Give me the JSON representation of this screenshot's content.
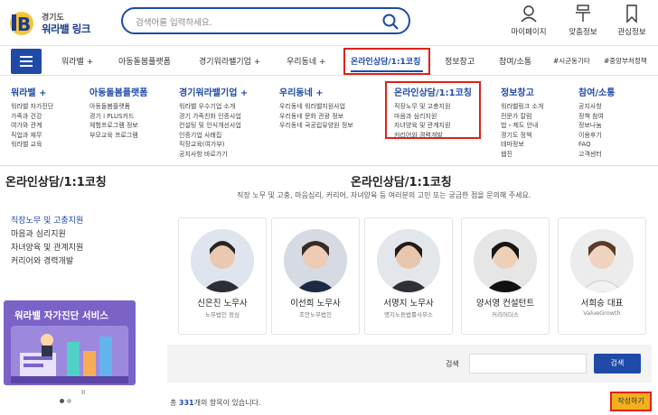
{
  "logo": {
    "line1": "경기도",
    "line2": "워라밸 링크"
  },
  "search": {
    "placeholder": "검색어를 입력하세요."
  },
  "utility": [
    {
      "label": "마이페이지",
      "icon": "user-icon"
    },
    {
      "label": "맞춤정보",
      "icon": "pin-icon"
    },
    {
      "label": "관심정보",
      "icon": "bookmark-icon"
    }
  ],
  "nav": {
    "items": [
      "워라밸 +",
      "아동돌봄플랫폼",
      "경기워라밸기업 +",
      "우리동네 +",
      "온라인상담/1:1코칭",
      "정보창고",
      "참여/소통"
    ],
    "tags": [
      "#시군동기타",
      "#중앙부처정책"
    ]
  },
  "mega_menu": [
    {
      "title": "워라밸 +",
      "items": [
        "워라밸 자가진단",
        "가족과 건강",
        "여가와 관계",
        "직업과 재무",
        "워라밸 교육"
      ]
    },
    {
      "title": "아동돌봄플랫폼",
      "items": [
        "아동돌봄플랫폼",
        "경기 i PLUS카드",
        "체험프로그램 정보",
        "부모교육 프로그램"
      ]
    },
    {
      "title": "경기워라밸기업 +",
      "items": [
        "워라밸 우수기업 소개",
        "경기 가족친화 인증사업",
        "컨설팅 및 인식개선사업",
        "인증기업 사례집",
        "직장교육(여가부)",
        "공지사항 바로가기"
      ]
    },
    {
      "title": "우리동네 +",
      "items": [
        "우리동네 워라밸지원사업",
        "우리동네 문화 관광 정보",
        "우리동네 국공립유양원 정보"
      ]
    },
    {
      "title": "온라인상담/1:1코칭",
      "items": [
        "직장노무 및 고충지원",
        "마음과 심리지원",
        "자녀양육 및 관계지원",
        "커리어와 경력개발"
      ]
    },
    {
      "title": "정보창고",
      "items": [
        "워라밸링크 소개",
        "전문가 칼럼",
        "법・제도 안내",
        "경기도 정책",
        "테마정보",
        "웹진"
      ]
    },
    {
      "title": "참여/소통",
      "items": [
        "공지사항",
        "정책 참여",
        "정보나눔",
        "이용후기",
        "FAQ",
        "고객센터"
      ]
    }
  ],
  "sidebar": {
    "title": "온라인상담/1:1코칭",
    "items": [
      "직장노무 및 고충지원",
      "마음과 심리지원",
      "자녀양육 및 관계지원",
      "커리어와 경력개발"
    ]
  },
  "banner": {
    "title": "워라밸 자가진단 서비스",
    "pause": "II"
  },
  "main": {
    "title": "온라인상담/1:1코칭",
    "description": "직장 노무 및 고충, 마음심리, 커리어, 자녀양육 등 여러분의 고민 또는 궁금한 점을 문의해 주세요."
  },
  "counselors": [
    {
      "name": "신은진 노무사",
      "org": "노무법인 정심"
    },
    {
      "name": "이선희 노무사",
      "org": "조안노무법인"
    },
    {
      "name": "서명지 노무사",
      "org": "명지노동법률사무소"
    },
    {
      "name": "양서영 컨설턴트",
      "org": "커리어더스"
    },
    {
      "name": "서희승 대표",
      "org": "ValueGrowth"
    }
  ],
  "board_search": {
    "label": "검색",
    "button": "검색"
  },
  "total": {
    "prefix": "총 ",
    "count": "331",
    "suffix": "개의 항목이 있습니다."
  },
  "write_button": "작성하기",
  "colors": {
    "primary": "#1f4aa8",
    "highlight": "#e0211a",
    "banner": "#7b62c7",
    "write": "#f2b01e"
  }
}
